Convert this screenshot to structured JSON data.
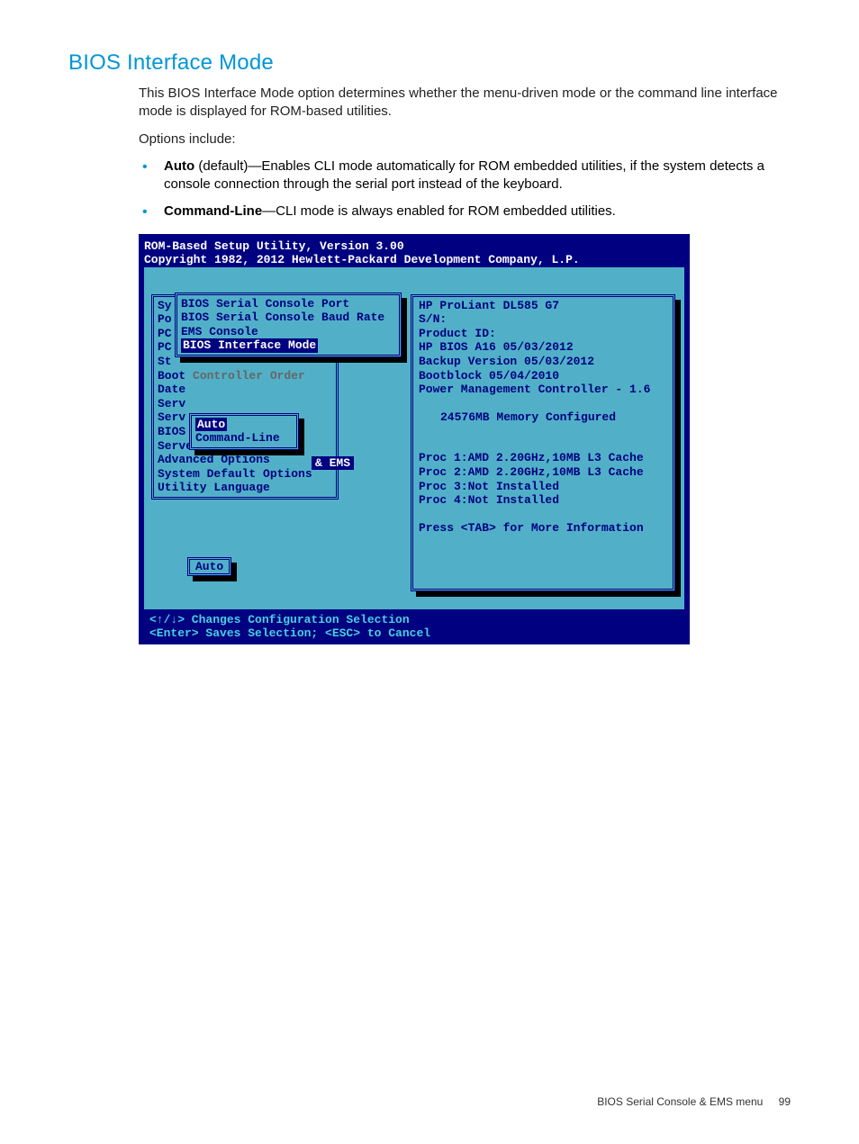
{
  "heading": "BIOS Interface Mode",
  "intro": "This BIOS Interface Mode option determines whether the menu-driven mode or the command line interface mode is displayed for ROM-based utilities.",
  "options_label": "Options include:",
  "bullets": [
    {
      "strong": "Auto",
      "rest": " (default)—Enables CLI mode automatically for ROM embedded utilities, if the system detects a console connection through the serial port instead of the keyboard."
    },
    {
      "strong": "Command-Line",
      "rest": "—CLI mode is always enabled for ROM embedded utilities."
    }
  ],
  "bios": {
    "title1": "ROM-Based Setup Utility, Version 3.00",
    "title2": "Copyright 1982, 2012 Hewlett-Packard Development Company, L.P.",
    "bg_menu": [
      {
        "text": "Sy",
        "grey": false
      },
      {
        "text": "Po",
        "grey": false
      },
      {
        "text": "PC",
        "grey": false
      },
      {
        "text": "PC",
        "grey": false
      },
      {
        "text": "St",
        "grey": false
      },
      {
        "text": "Boot Controller Order",
        "grey_after": "Controller Order",
        "prefix": "Boot "
      },
      {
        "text": "Date",
        "grey": false
      },
      {
        "text": "Serv",
        "grey": false
      },
      {
        "text": "Serv",
        "grey": false
      },
      {
        "text": "BIOS",
        "grey": false
      },
      {
        "text": "Server Asset Text",
        "grey_after": "Asset Text",
        "prefix": "Server "
      },
      {
        "text": "Advanced Options",
        "grey": false
      },
      {
        "text": "System Default Options",
        "grey": false
      },
      {
        "text": "Utility Language",
        "grey": false
      }
    ],
    "submenu": [
      {
        "text": "BIOS Serial Console Port",
        "selected": false
      },
      {
        "text": "BIOS Serial Console Baud Rate",
        "selected": false
      },
      {
        "text": "EMS Console",
        "selected": false
      },
      {
        "text": "BIOS Interface Mode",
        "selected": true
      }
    ],
    "dropdown": [
      {
        "text": "Auto",
        "selected": true
      },
      {
        "text": "Command-Line",
        "selected": false
      }
    ],
    "ems_chip": "& EMS",
    "status_chip": "Auto",
    "info": [
      "HP ProLiant DL585 G7",
      "S/N:",
      "Product ID:",
      "HP BIOS A16 05/03/2012",
      "Backup Version 05/03/2012",
      "Bootblock 05/04/2010",
      "Power Management Controller - 1.6",
      "",
      "   24576MB Memory Configured",
      "",
      "",
      "Proc 1:AMD 2.20GHz,10MB L3 Cache",
      "Proc 2:AMD 2.20GHz,10MB L3 Cache",
      "Proc 3:Not Installed",
      "Proc 4:Not Installed",
      "",
      "Press <TAB> for More Information"
    ],
    "footer1": "<↑/↓> Changes Configuration Selection",
    "footer2": "<Enter> Saves Selection; <ESC> to Cancel"
  },
  "footer": {
    "title": "BIOS Serial Console & EMS menu",
    "page": "99"
  }
}
